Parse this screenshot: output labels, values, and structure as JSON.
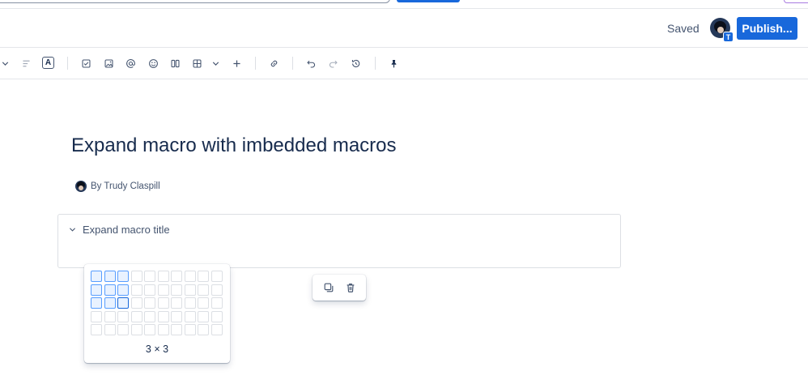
{
  "header": {
    "save_status": "Saved",
    "avatar_badge": "T",
    "publish_label": "Publish..."
  },
  "toolbar": {
    "text_color_label": "A",
    "icons": [
      "chevron-down-icon",
      "align-icon",
      "text-color-icon",
      "checkbox-icon",
      "image-icon",
      "mention-icon",
      "emoji-icon",
      "layout-icon",
      "table-icon",
      "chevron-down-icon",
      "plus-icon",
      "link-icon",
      "undo-icon",
      "redo-icon",
      "history-icon",
      "pin-icon"
    ]
  },
  "page": {
    "title": "Expand macro with imbedded macros",
    "byline": "By Trudy Claspill"
  },
  "expand_macro": {
    "title": "Expand macro title"
  },
  "table_picker": {
    "columns": 10,
    "rows": 5,
    "selected_columns": 3,
    "selected_rows": 3,
    "label": "3 × 3"
  },
  "colors": {
    "brand_blue": "#1868db",
    "text": "#172b4d",
    "subtle_text": "#44546f",
    "selected_cell_bg": "#e9f2ff",
    "selected_cell_border": "#579dff"
  }
}
